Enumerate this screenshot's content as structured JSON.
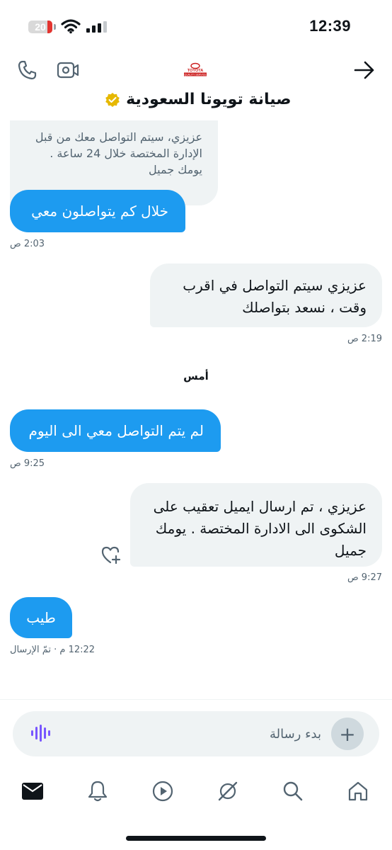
{
  "status_bar": {
    "time": "12:39",
    "battery_level": "20",
    "battery_percent": 20,
    "battery_color": "#e3342f"
  },
  "header": {
    "logo_text": "TOYOTA",
    "logo_subtext": "QUALITY SERVICE",
    "title": "صيانة تويوتا السعودية",
    "verified_color": "#e6b800"
  },
  "messages": [
    {
      "type": "received",
      "text": "عزيزي، سيتم التواصل معك من قبل\nالإدارة المختصة خلال 24 ساعة .\nيومك جميل"
    },
    {
      "type": "sent",
      "text": "خلال كم يتواصلون معي",
      "time": "2:03 ص"
    },
    {
      "type": "received",
      "text": "عزيزي سيتم التواصل  في اقرب\nوقت  ،  نسعد بتواصلك",
      "time": "2:19 ص"
    },
    {
      "type": "sent",
      "text": "لم يتم التواصل معي الى اليوم",
      "time": "9:25 ص"
    },
    {
      "type": "received",
      "text": "عزيزي ، تم ارسال ايميل تعقيب على\nالشكوى الى الادارة المختصة . يومك\nجميل",
      "time": "9:27 ص"
    },
    {
      "type": "sent",
      "text": "طيب",
      "time": "12:22 م · تمّ الإرسال"
    }
  ],
  "day_separator": "أمس",
  "composer": {
    "placeholder": "بدء رسالة",
    "plus": "+"
  },
  "colors": {
    "sent_bubble": "#1d9bf0",
    "received_bubble": "#eff3f4",
    "accent_voice": "#7856ff"
  },
  "nav": [
    "mail-icon",
    "bell-icon",
    "play-icon",
    "grok-icon",
    "search-icon",
    "home-icon"
  ]
}
